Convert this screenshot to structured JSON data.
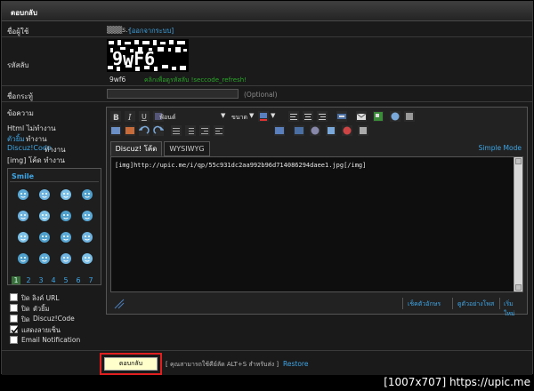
{
  "panel": {
    "title": "ตอบกลับ"
  },
  "username_row": {
    "label": "ชื่อผู้ใช้",
    "value": "▒▒▒s.-",
    "logout": "[ออกจากระบบ]"
  },
  "captcha_row": {
    "label": "รหัสลับ",
    "code": "9wf6",
    "refresh_hint": "คลิกเพื่อดูรหัสลับ !seccode_refresh!"
  },
  "subject_row": {
    "label": "ชื่อกระทู้",
    "optional": "(Optional)"
  },
  "message_row": {
    "label": "ข้อความ",
    "html_status": "Html ไม่ทำงาน",
    "smilies_label": "ตัวยิ้ม",
    "smilies_status": "ทำงาน",
    "discuz_label": "Discuz!Code",
    "discuz_status": "ทำงาน",
    "img_status": "[img] โค้ด ทำงาน"
  },
  "toolbar": {
    "font_label": "ฟ้อนต์",
    "size_label": "ขนาด"
  },
  "editor": {
    "tab_discuz": "Discuz! โค้ด",
    "tab_wysiwyg": "WYSIWYG",
    "simple_mode": "Simple Mode",
    "content": "[img]http://upic.me/i/qp/55c931dc2aa992b96d714086294daee1.jpg[/img]",
    "btn_chars": "เช็คตัวอักษร",
    "btn_preview": "ดูตัวอย่างโพส",
    "btn_clear": "เริ่มใหม่"
  },
  "smile_panel": {
    "title": "Smile",
    "pages": [
      "1",
      "2",
      "3",
      "4",
      "5",
      "6",
      "7"
    ]
  },
  "options": [
    {
      "label_pre": "ปิด ลิงค์ URL",
      "label_link": "",
      "checked": false
    },
    {
      "label_pre": "ปิด ",
      "label_link": "ตัวยิ้ม",
      "checked": false
    },
    {
      "label_pre": "ปิด ",
      "label_link": "Discuz!Code",
      "checked": false
    },
    {
      "label_pre": "แสดงลายเซ็น",
      "label_link": "",
      "checked": true
    },
    {
      "label_pre": "Email Notification",
      "label_link": "",
      "checked": false
    }
  ],
  "footer": {
    "submit": "ตอบกลับ",
    "hint": "[ คุณสามารถใช้คีย์ลัด ALT+S สำหรับส่ง ]",
    "restore": "Restore"
  },
  "watermark": "[1007x707] https://upic.me",
  "colors": {
    "link": "#3fa6e6",
    "highlight_border": "#e02020",
    "submit_bg": "#ffffcc"
  }
}
